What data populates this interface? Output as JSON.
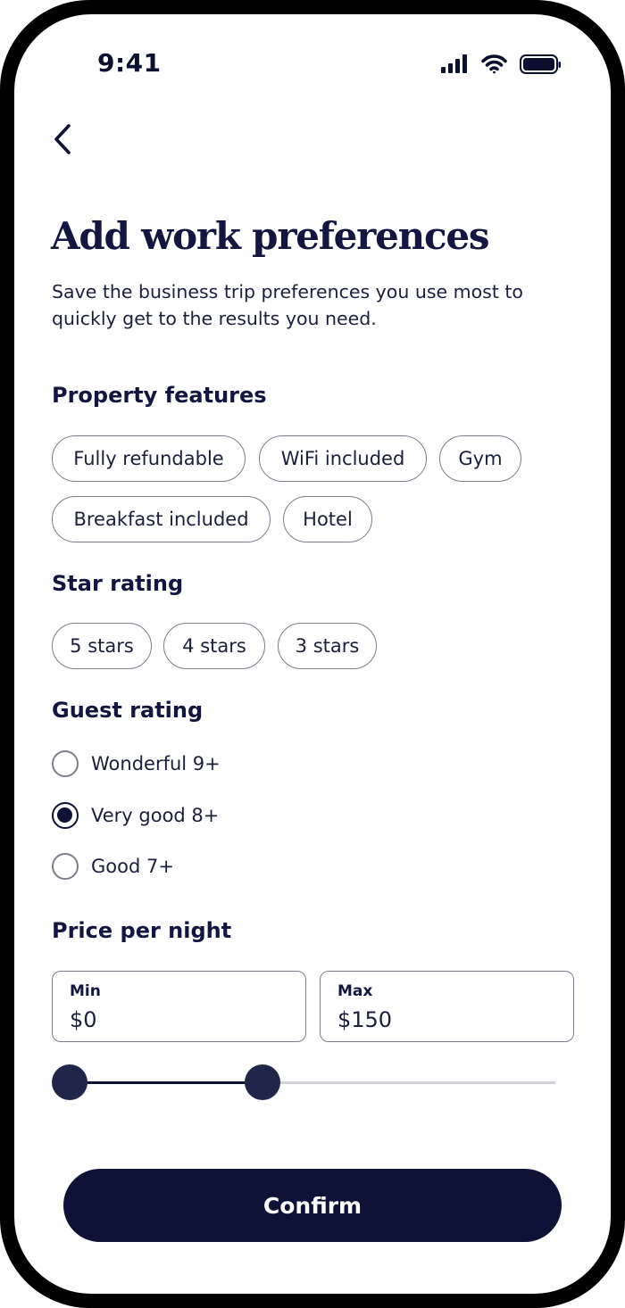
{
  "status_bar": {
    "time": "9:41",
    "icons": [
      "cellular-signal-icon",
      "wifi-icon",
      "battery-icon"
    ]
  },
  "header": {
    "back_icon": "chevron-left-icon",
    "title": "Add work preferences",
    "subtitle": "Save the business trip preferences you use most to quickly get to the results you need."
  },
  "property_features": {
    "label": "Property features",
    "chips": [
      {
        "label": "Fully refundable",
        "selected": false
      },
      {
        "label": "WiFi included",
        "selected": true
      },
      {
        "label": "Gym",
        "selected": true
      },
      {
        "label": "Breakfast included",
        "selected": false
      },
      {
        "label": "Hotel",
        "selected": false
      }
    ]
  },
  "star_rating": {
    "label": "Star rating",
    "chips": [
      {
        "label": "5 stars",
        "selected": false
      },
      {
        "label": "4 stars",
        "selected": false
      },
      {
        "label": "3 stars",
        "selected": false
      }
    ]
  },
  "guest_rating": {
    "label": "Guest rating",
    "options": [
      {
        "label": "Wonderful 9+",
        "checked": false
      },
      {
        "label": "Very good 8+",
        "checked": true
      },
      {
        "label": "Good 7+",
        "checked": false
      }
    ]
  },
  "price": {
    "label": "Price per night",
    "min_label": "Min",
    "min_value": "$0",
    "max_label": "Max",
    "max_value": "$150",
    "slider": {
      "min_fraction": 0.0,
      "max_fraction": 0.4
    }
  },
  "confirm_label": "Confirm",
  "colors": {
    "primary": "#0d1236",
    "chip_selected_bg": "#eef2fb",
    "border": "#7b7f8c"
  }
}
